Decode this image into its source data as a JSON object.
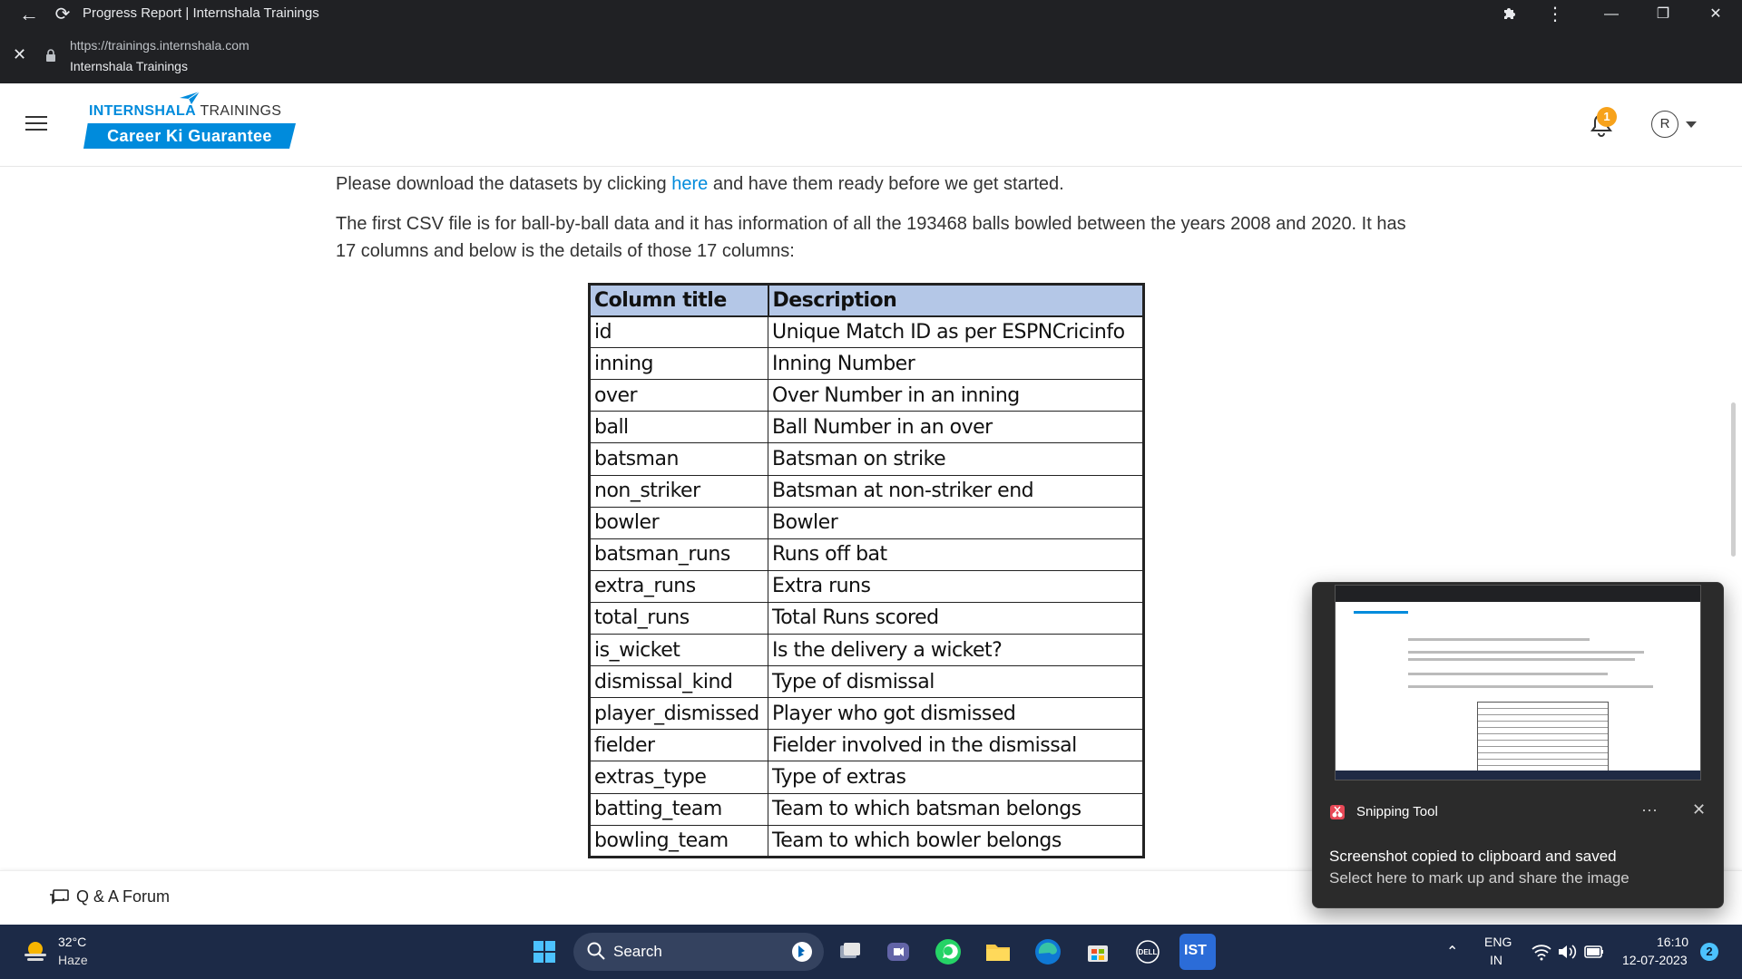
{
  "browser": {
    "tab_title": "Progress Report | Internshala Trainings",
    "url": "https://trainings.internshala.com",
    "site_name": "Internshala Trainings",
    "window_controls": {
      "minimize": "—",
      "restore": "❐",
      "close": "✕"
    }
  },
  "header": {
    "logo_brand": "INTERNSHALA",
    "logo_suffix": "TRAININGS",
    "logo_tagline": "Career Ki Guarantee",
    "notification_count": "1",
    "avatar_initial": "R",
    "colors": {
      "brand": "#008bdc",
      "badge": "#f7a21b"
    }
  },
  "content": {
    "para1_before": "Please download the datasets by clicking ",
    "para1_link": "here",
    "para1_after": " and have them ready before we get started.",
    "para2": "The first CSV file is for ball-by-ball data and it has information of all the 193468 balls bowled between the years 2008 and 2020. It has 17 columns and below is the details of those 17 columns:",
    "table": {
      "headers": [
        "Column title",
        "Description"
      ],
      "header_color": "#b4c7e7",
      "rows": [
        [
          "id",
          "Unique Match ID as per ESPNCricinfo"
        ],
        [
          "inning",
          "Inning Number"
        ],
        [
          "over",
          "Over Number in an inning"
        ],
        [
          "ball",
          "Ball Number in an over"
        ],
        [
          "batsman",
          "Batsman on strike"
        ],
        [
          "non_striker",
          "Batsman at non-striker end"
        ],
        [
          "bowler",
          "Bowler"
        ],
        [
          "batsman_runs",
          "Runs off bat"
        ],
        [
          "extra_runs",
          "Extra runs"
        ],
        [
          "total_runs",
          "Total Runs scored"
        ],
        [
          "is_wicket",
          "Is the delivery a wicket?"
        ],
        [
          "dismissal_kind",
          "Type of dismissal"
        ],
        [
          "player_dismissed",
          "Player who got dismissed"
        ],
        [
          "fielder",
          "Fielder involved in the dismissal"
        ],
        [
          "extras_type",
          "Type of extras"
        ],
        [
          "batting_team",
          "Team to which batsman belongs"
        ],
        [
          "bowling_team",
          "Team to which bowler belongs"
        ]
      ]
    }
  },
  "footer": {
    "qa_label": "Q & A Forum"
  },
  "toast": {
    "app_name": "Snipping Tool",
    "more": "···",
    "close": "✕",
    "message_title": "Screenshot copied to clipboard and saved",
    "message_body": "Select here to mark up and share the image"
  },
  "taskbar": {
    "weather_temp": "32°C",
    "weather_desc": "Haze",
    "search_label": "Search",
    "lang_line1": "ENG",
    "lang_line2": "IN",
    "time": "16:10",
    "date": "12-07-2023",
    "notification_count": "2",
    "ist_label": "IST"
  }
}
